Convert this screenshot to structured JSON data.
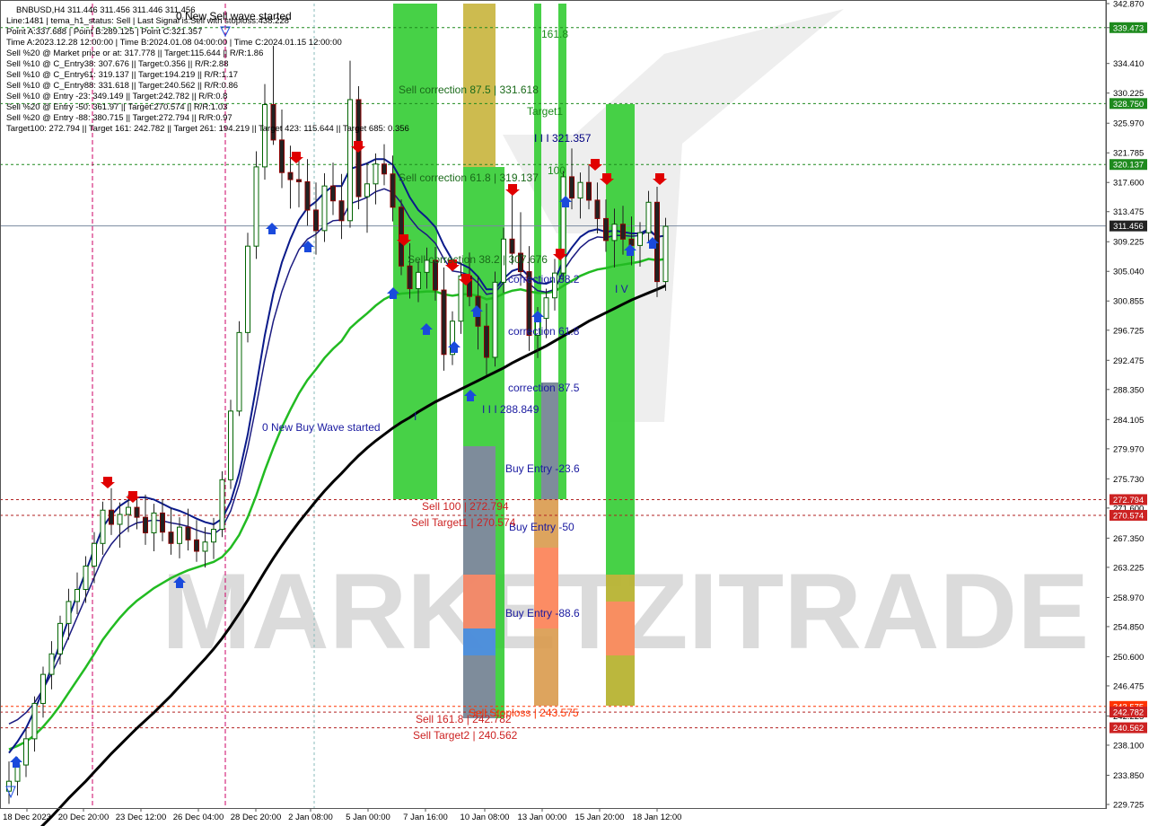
{
  "chart_data": {
    "type": "candlestick",
    "symbol_line": "BNBUSD,H4  311.446 311.456 311.446 311.456",
    "info_lines": [
      "Line:1481 | tema_h1_status: Sell | Last Signal is:Sell with stoploss:438.228",
      "Point A:337.688 | Point B:289.125 | Point C:321.357",
      "Time A:2023.12.28 12:00:00 | Time B:2024.01.08 04:00:00 | Time C:2024.01.15 12:00:00",
      "Sell %20 @ Market price or at: 317.778 || Target:115.644 || R/R:1.86",
      "Sell %10 @ C_Entry38: 307.676 || Target:0.356 || R/R:2.88",
      "Sell %10 @ C_Entry61: 319.137 || Target:194.219 || R/R:1.17",
      "Sell %10 @ C_Entry88: 331.618 || Target:240.562 || R/R:0.86",
      "Sell %10 @ Entry -23: 349.149 || Target:242.782 || R/R:0.8",
      "Sell %20 @ Entry -50: 361.97 || Target:270.574 || R/R:1.03",
      "Sell %20 @ Entry -88: 380.715 || Target:272.794 || R/R:0.97",
      "Target100: 272.794 || Target 161: 242.782 || Target 261: 194.219 || Target 423: 115.644 || Target 685: 0.356"
    ],
    "y_ticks": [
      "342.870",
      "339.473",
      "334.410",
      "330.225",
      "325.970",
      "321.785",
      "317.600",
      "313.475",
      "309.225",
      "305.040",
      "300.855",
      "296.725",
      "292.475",
      "288.350",
      "284.105",
      "279.970",
      "275.730",
      "271.600",
      "267.350",
      "263.225",
      "258.970",
      "254.850",
      "250.600",
      "246.475",
      "242.225",
      "238.100",
      "233.850",
      "229.725"
    ],
    "x_ticks": [
      "18 Dec 2023",
      "20 Dec 20:00",
      "23 Dec 12:00",
      "26 Dec 04:00",
      "28 Dec 20:00",
      "2 Jan 08:00",
      "5 Jan 00:00",
      "7 Jan 16:00",
      "10 Jan 08:00",
      "13 Jan 00:00",
      "15 Jan 20:00",
      "18 Jan 12:00"
    ],
    "price_tags": [
      {
        "value": "339.473",
        "color": "#1e8a1e"
      },
      {
        "value": "328.750",
        "color": "#1e8a1e"
      },
      {
        "value": "320.137",
        "color": "#1e8a1e"
      },
      {
        "value": "311.456",
        "color": "#222222"
      },
      {
        "value": "272.794",
        "color": "#cc2222"
      },
      {
        "value": "270.574",
        "color": "#cc2222"
      },
      {
        "value": "243.575",
        "color": "#ff3300"
      },
      {
        "value": "242.782",
        "color": "#cc2222"
      },
      {
        "value": "240.562",
        "color": "#cc2222"
      }
    ],
    "annotations": [
      {
        "text": "0 New Sell wave started",
        "color": "#000000"
      },
      {
        "text": "0 New Buy Wave started",
        "color": "#1a1aa0"
      },
      {
        "text": "Sell correction 87.5 | 331.618",
        "color": "#1a6a1a"
      },
      {
        "text": "Sell correction 61.8 | 319.137",
        "color": "#1a6a1a"
      },
      {
        "text": "Sell correction 38.2 | 307.676",
        "color": "#1a6a1a"
      },
      {
        "text": "161.8",
        "color": "#1a8a1a"
      },
      {
        "text": "Target1",
        "color": "#1a8a1a"
      },
      {
        "text": "I I I 321.357",
        "color": "#000080"
      },
      {
        "text": "100",
        "color": "#1a8a1a"
      },
      {
        "text": "I V",
        "color": "#1a1aa0"
      },
      {
        "text": "I",
        "color": "#1a1aa0"
      },
      {
        "text": "correction 38.2",
        "color": "#1a1aa0"
      },
      {
        "text": "correction 61.8",
        "color": "#1a1aa0"
      },
      {
        "text": "correction 87.5",
        "color": "#1a1aa0"
      },
      {
        "text": "I I I 288.849",
        "color": "#1a1aa0"
      },
      {
        "text": "Buy Entry -23.6",
        "color": "#1a1aa0"
      },
      {
        "text": "Buy Entry -50",
        "color": "#1a1aa0"
      },
      {
        "text": "Buy Entry -88.6",
        "color": "#1a1aa0"
      },
      {
        "text": "Sell 100 | 272.794",
        "color": "#cc2222"
      },
      {
        "text": "Sell Target1 | 270.574",
        "color": "#cc2222"
      },
      {
        "text": "Sell Stoploss | 243.575",
        "color": "#ff3300"
      },
      {
        "text": "Sell 161.8 | 242.782",
        "color": "#cc2222"
      },
      {
        "text": "Sell Target2 | 240.562",
        "color": "#cc2222"
      }
    ],
    "watermark": "MARKETZITRADE",
    "y_range": [
      229.725,
      342.87
    ],
    "series": {
      "candles": [
        [
          231.6,
          235.8,
          229.8,
          233.0
        ],
        [
          233.0,
          236.4,
          231.0,
          235.3
        ],
        [
          235.3,
          240.5,
          233.6,
          239.0
        ],
        [
          239.0,
          245.0,
          237.2,
          244.0
        ],
        [
          244.0,
          249.2,
          242.0,
          248.1
        ],
        [
          248.1,
          252.8,
          246.0,
          251.0
        ],
        [
          251.0,
          256.4,
          249.5,
          255.3
        ],
        [
          255.3,
          260.2,
          253.0,
          258.4
        ],
        [
          258.4,
          262.5,
          256.6,
          260.1
        ],
        [
          260.1,
          264.8,
          258.2,
          263.4
        ],
        [
          263.4,
          268.2,
          261.0,
          266.6
        ],
        [
          266.6,
          272.5,
          265.0,
          271.3
        ],
        [
          271.3,
          274.4,
          267.8,
          269.3
        ],
        [
          269.3,
          272.4,
          266.0,
          270.7
        ],
        [
          270.7,
          273.5,
          268.2,
          271.7
        ],
        [
          271.7,
          273.8,
          268.6,
          270.3
        ],
        [
          270.3,
          273.5,
          266.4,
          268.1
        ],
        [
          268.1,
          272.2,
          265.5,
          270.9
        ],
        [
          270.9,
          272.8,
          266.9,
          268.2
        ],
        [
          268.2,
          271.6,
          265.0,
          266.6
        ],
        [
          266.6,
          270.3,
          264.5,
          268.9
        ],
        [
          268.9,
          271.5,
          265.6,
          267.1
        ],
        [
          267.1,
          269.9,
          264.0,
          265.5
        ],
        [
          265.5,
          268.9,
          263.2,
          266.8
        ],
        [
          266.8,
          270.2,
          264.4,
          268.6
        ],
        [
          268.6,
          276.8,
          267.5,
          275.6
        ],
        [
          275.6,
          286.9,
          274.3,
          285.3
        ],
        [
          285.3,
          298.0,
          284.6,
          296.4
        ],
        [
          296.4,
          310.5,
          295.0,
          308.6
        ],
        [
          308.6,
          322.0,
          306.8,
          319.8
        ],
        [
          319.8,
          331.5,
          318.0,
          328.6
        ],
        [
          328.6,
          336.9,
          322.9,
          323.6
        ],
        [
          323.6,
          327.9,
          316.8,
          319.0
        ],
        [
          319.0,
          322.8,
          313.9,
          318.0
        ],
        [
          318.0,
          321.4,
          314.1,
          317.7
        ],
        [
          317.7,
          320.9,
          311.5,
          313.7
        ],
        [
          313.7,
          317.6,
          307.4,
          310.8
        ],
        [
          310.8,
          318.9,
          309.2,
          317.1
        ],
        [
          317.1,
          320.4,
          313.0,
          315.0
        ],
        [
          315.0,
          318.8,
          309.6,
          312.2
        ],
        [
          312.2,
          334.8,
          311.2,
          329.3
        ],
        [
          329.3,
          331.2,
          313.8,
          315.6
        ],
        [
          315.6,
          320.4,
          310.5,
          317.4
        ],
        [
          317.4,
          321.7,
          314.5,
          320.2
        ],
        [
          320.2,
          323.0,
          317.2,
          318.8
        ],
        [
          318.8,
          321.4,
          312.1,
          314.1
        ],
        [
          314.1,
          315.2,
          304.5,
          305.8
        ],
        [
          305.8,
          309.0,
          301.2,
          302.6
        ],
        [
          302.6,
          306.5,
          300.7,
          304.9
        ],
        [
          304.9,
          308.4,
          302.6,
          306.6
        ],
        [
          306.6,
          308.5,
          300.9,
          302.4
        ],
        [
          302.4,
          305.6,
          291.0,
          293.3
        ],
        [
          293.3,
          299.4,
          291.8,
          298.0
        ],
        [
          298.0,
          306.2,
          296.2,
          304.4
        ],
        [
          304.4,
          307.7,
          300.1,
          301.5
        ],
        [
          301.5,
          304.4,
          294.0,
          297.3
        ],
        [
          297.3,
          300.5,
          290.4,
          292.9
        ],
        [
          292.9,
          305.0,
          291.6,
          303.5
        ],
        [
          303.5,
          311.2,
          302.0,
          309.6
        ],
        [
          309.6,
          315.8,
          306.0,
          307.6
        ],
        [
          307.6,
          313.4,
          303.0,
          305.0
        ],
        [
          305.0,
          308.6,
          293.8,
          296.0
        ],
        [
          296.0,
          300.0,
          292.8,
          298.4
        ],
        [
          298.4,
          302.6,
          295.6,
          301.3
        ],
        [
          301.3,
          306.8,
          299.5,
          304.8
        ],
        [
          304.8,
          319.2,
          303.9,
          318.4
        ],
        [
          318.4,
          322.4,
          313.8,
          315.4
        ],
        [
          315.4,
          319.0,
          312.5,
          317.6
        ],
        [
          317.6,
          320.0,
          313.8,
          315.1
        ],
        [
          315.1,
          317.6,
          310.4,
          312.5
        ],
        [
          312.5,
          315.2,
          307.8,
          309.4
        ],
        [
          309.4,
          313.9,
          305.6,
          311.7
        ],
        [
          311.7,
          314.3,
          307.4,
          309.6
        ],
        [
          309.6,
          312.8,
          305.9,
          308.7
        ],
        [
          308.7,
          312.0,
          305.7,
          310.5
        ],
        [
          310.5,
          316.4,
          309.0,
          314.8
        ],
        [
          314.8,
          317.0,
          301.4,
          303.6
        ],
        [
          303.6,
          312.6,
          302.3,
          311.4
        ]
      ],
      "ema_slow": [
        222.6,
        223.5,
        224.5,
        225.6,
        226.8,
        228.0,
        229.3,
        230.6,
        231.8,
        233.0,
        234.3,
        235.6,
        236.9,
        238.1,
        239.3,
        240.5,
        241.6,
        242.7,
        243.9,
        245.1,
        246.4,
        247.7,
        249.0,
        250.3,
        251.7,
        253.2,
        254.9,
        256.7,
        258.6,
        260.6,
        262.6,
        264.5,
        266.3,
        268.0,
        269.6,
        271.1,
        272.6,
        274.0,
        275.3,
        276.5,
        277.8,
        279.0,
        280.1,
        281.1,
        282.0,
        282.9,
        283.7,
        284.4,
        285.2,
        285.9,
        286.6,
        287.2,
        287.8,
        288.4,
        289.0,
        289.6,
        290.2,
        290.8,
        291.4,
        292.1,
        292.7,
        293.3,
        293.9,
        294.5,
        295.2,
        295.9,
        296.6,
        297.3,
        298.0,
        298.6,
        299.2,
        299.8,
        300.4,
        301.0,
        301.5,
        302.0,
        302.5,
        303.0
      ],
      "ma_fast": [
        241.1,
        241.7,
        242.7,
        244.1,
        246.0,
        248.2,
        250.7,
        253.4,
        256.2,
        259.0,
        261.8,
        264.6,
        266.5,
        267.9,
        268.9,
        269.5,
        269.7,
        269.9,
        269.8,
        269.5,
        269.3,
        269.0,
        268.5,
        268.1,
        267.9,
        268.8,
        271.2,
        275.0,
        280.1,
        286.1,
        292.5,
        298.0,
        302.2,
        305.5,
        308.1,
        309.6,
        310.3,
        311.5,
        312.2,
        312.3,
        314.6,
        315.0,
        315.5,
        316.3,
        316.7,
        316.2,
        314.7,
        312.6,
        311.1,
        310.2,
        309.0,
        306.8,
        305.1,
        304.9,
        304.5,
        303.4,
        301.8,
        302.0,
        303.5,
        304.4,
        304.6,
        303.3,
        302.3,
        302.1,
        302.5,
        305.1,
        306.9,
        308.4,
        309.4,
        309.9,
        309.8,
        310.1,
        310.1,
        310.0,
        310.1,
        310.8,
        309.9,
        310.1
      ],
      "ma_mid": [
        237.5,
        238.0,
        238.6,
        239.5,
        240.7,
        242.1,
        243.7,
        245.5,
        247.3,
        249.1,
        251.0,
        253.0,
        254.6,
        256.1,
        257.4,
        258.5,
        259.4,
        260.3,
        261.0,
        261.7,
        262.3,
        262.8,
        263.2,
        263.6,
        264.0,
        264.7,
        266.0,
        267.8,
        270.3,
        273.4,
        276.9,
        280.1,
        283.0,
        285.5,
        287.8,
        289.7,
        291.2,
        292.8,
        294.1,
        295.2,
        297.0,
        298.1,
        299.1,
        300.2,
        301.1,
        301.7,
        301.9,
        302.0,
        302.1,
        302.2,
        302.2,
        301.8,
        301.6,
        301.8,
        301.8,
        301.6,
        301.1,
        301.3,
        301.9,
        302.3,
        302.5,
        302.2,
        302.0,
        302.0,
        302.2,
        303.0,
        303.7,
        304.4,
        304.9,
        305.3,
        305.5,
        305.8,
        306.0,
        306.2,
        306.4,
        306.8,
        306.6,
        306.8
      ],
      "ma_trend_blue": [
        237.0,
        238.6,
        240.5,
        243.0,
        245.9,
        249.1,
        252.5,
        256.0,
        259.4,
        262.6,
        265.8,
        268.9,
        270.6,
        271.9,
        272.7,
        273.1,
        273.1,
        272.8,
        272.2,
        271.6,
        271.2,
        270.7,
        270.1,
        269.6,
        269.3,
        270.1,
        272.5,
        276.5,
        282.0,
        288.8,
        296.0,
        301.9,
        306.3,
        309.6,
        312.3,
        314.0,
        314.9,
        316.2,
        317.1,
        317.1,
        319.5,
        319.9,
        320.3,
        320.9,
        320.9,
        320.1,
        318.0,
        315.5,
        313.7,
        312.6,
        311.3,
        308.7,
        306.6,
        306.1,
        305.5,
        304.3,
        302.5,
        302.5,
        304.0,
        305.1,
        305.5,
        304.3,
        303.4,
        303.3,
        303.8,
        306.6,
        308.4,
        309.9,
        310.7,
        311.0,
        310.6,
        310.8,
        310.6,
        310.4,
        310.4,
        311.0,
        309.9,
        310.1
      ]
    }
  }
}
